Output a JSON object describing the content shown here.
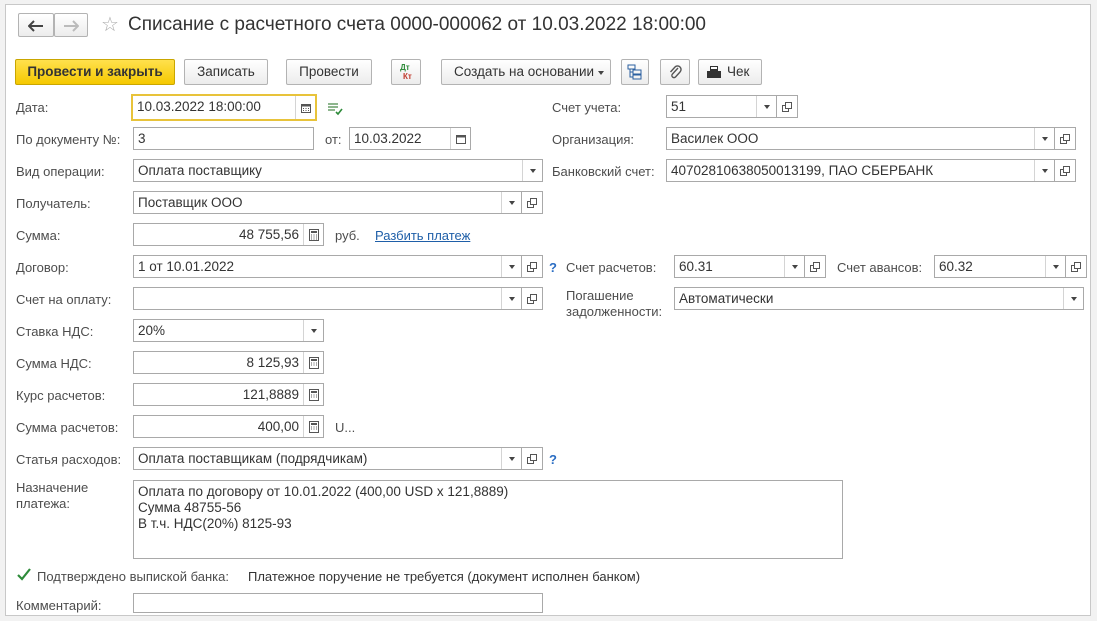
{
  "window": {
    "title": "Списание с расчетного счета 0000-000062 от 10.03.2022 18:00:00"
  },
  "toolbar": {
    "post_close": "Провести и закрыть",
    "save": "Записать",
    "post": "Провести",
    "dtkt_top": "Дт",
    "dtkt_bottom": "Кт",
    "create_based": "Создать на основании",
    "check": "Чек"
  },
  "form": {
    "date_label": "Дата:",
    "date_value": "10.03.2022 18:00:00",
    "docnum_label": "По документу №:",
    "docnum_value": "3",
    "from_label": "от:",
    "from_value": "10.03.2022",
    "optype_label": "Вид операции:",
    "optype_value": "Оплата поставщику",
    "recipient_label": "Получатель:",
    "recipient_value": "Поставщик ООО",
    "sum_label": "Сумма:",
    "sum_value": "48 755,56",
    "sum_currency": "руб.",
    "split_link": "Разбить платеж",
    "contract_label": "Договор:",
    "contract_value": "1 от 10.01.2022",
    "invoice_label": "Счет на оплату:",
    "invoice_value": "",
    "vat_rate_label": "Ставка НДС:",
    "vat_rate_value": "20%",
    "vat_sum_label": "Сумма НДС:",
    "vat_sum_value": "8 125,93",
    "rate_label": "Курс расчетов:",
    "rate_value": "121,8889",
    "settle_sum_label": "Сумма расчетов:",
    "settle_sum_value": "400,00",
    "settle_currency": "U...",
    "expense_label": "Статья расходов:",
    "expense_value": "Оплата поставщикам (подрядчикам)",
    "purpose_label_1": "Назначение",
    "purpose_label_2": "платежа:",
    "purpose_line_1": "Оплата по договору от 10.01.2022 (400,00 USD x 121,8889)",
    "purpose_line_2": "Сумма 48755-56",
    "purpose_line_3": "В т.ч. НДС(20%) 8125-93",
    "confirmed_label": "Подтверждено выпиской банка:",
    "payment_order_note": "Платежное поручение не требуется (документ исполнен банком)",
    "comment_label": "Комментарий:",
    "comment_value": "",
    "account_label": "Счет учета:",
    "account_value": "51",
    "org_label": "Организация:",
    "org_value": "Василек ООО",
    "bank_label": "Банковский счет:",
    "bank_value": "40702810638050013199, ПАО СБЕРБАНК",
    "settle_acc_label": "Счет расчетов:",
    "settle_acc_value": "60.31",
    "advance_acc_label": "Счет авансов:",
    "advance_acc_value": "60.32",
    "repay_label_1": "Погашение",
    "repay_label_2": "задолженности:",
    "repay_value": "Автоматически",
    "help": "?"
  },
  "colors": {
    "primary": "#f5c900",
    "link": "#1f5fa8",
    "check": "#2e8b3a"
  },
  "icons": [
    "back-arrow-icon",
    "forward-arrow-icon",
    "favorite-star-icon",
    "calendar-icon",
    "calculator-icon",
    "open-form-icon",
    "dropdown-arrow-icon",
    "structure-icon",
    "paperclip-icon",
    "cash-register-icon",
    "checkmark-icon"
  ]
}
